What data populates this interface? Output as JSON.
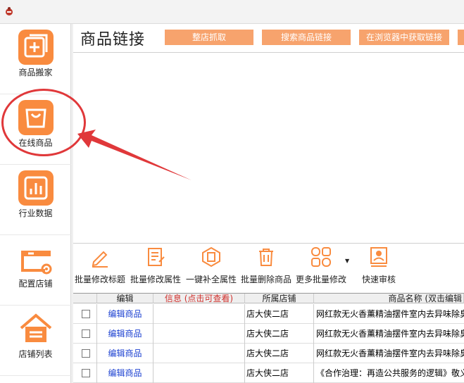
{
  "sidebar": {
    "items": [
      {
        "label": "商品搬家",
        "icon": "plus-box-icon"
      },
      {
        "label": "在线商品",
        "icon": "shopping-bag-icon"
      },
      {
        "label": "行业数据",
        "icon": "bar-chart-icon"
      },
      {
        "label": "配置店铺",
        "icon": "store-gear-icon"
      },
      {
        "label": "店铺列表",
        "icon": "house-list-icon"
      }
    ]
  },
  "main": {
    "title": "商品链接",
    "buttons": [
      "整店抓取",
      "搜索商品链接",
      "在浏览器中获取链接"
    ]
  },
  "toolbar": {
    "items": [
      {
        "label": "批量修改标题",
        "icon": "pencil-icon"
      },
      {
        "label": "批量修改属性",
        "icon": "form-edit-icon"
      },
      {
        "label": "一键补全属性",
        "icon": "hexagon-document-icon"
      },
      {
        "label": "批量删除商品",
        "icon": "trash-icon"
      },
      {
        "label": "更多批量修改",
        "icon": "grid-circles-icon"
      },
      {
        "label": "快速审核",
        "icon": "review-user-icon"
      }
    ]
  },
  "table": {
    "headers": [
      "编辑",
      "信息 (点击可查看)",
      "所属店铺",
      "商品名称 (双击编辑"
    ],
    "rows": [
      {
        "edit": "编辑商品",
        "info": "",
        "shop": "店大侠二店",
        "name": "网红款无火香薰精油摆件室内去异味除臭"
      },
      {
        "edit": "编辑商品",
        "info": "",
        "shop": "店大侠二店",
        "name": "网红款无火香薰精油摆件室内去异味除臭"
      },
      {
        "edit": "编辑商品",
        "info": "",
        "shop": "店大侠二店",
        "name": "网红款无火香薰精油摆件室内去异味除臭"
      },
      {
        "edit": "编辑商品",
        "info": "",
        "shop": "店大侠二店",
        "name": "《合作治理：再造公共服务的逻辑》敬义"
      }
    ]
  },
  "colors": {
    "accent": "#f98b3f",
    "button": "#f7a36d",
    "annotation": "#e0383a",
    "link": "#1a3fd0",
    "header_red": "#d0312d"
  }
}
